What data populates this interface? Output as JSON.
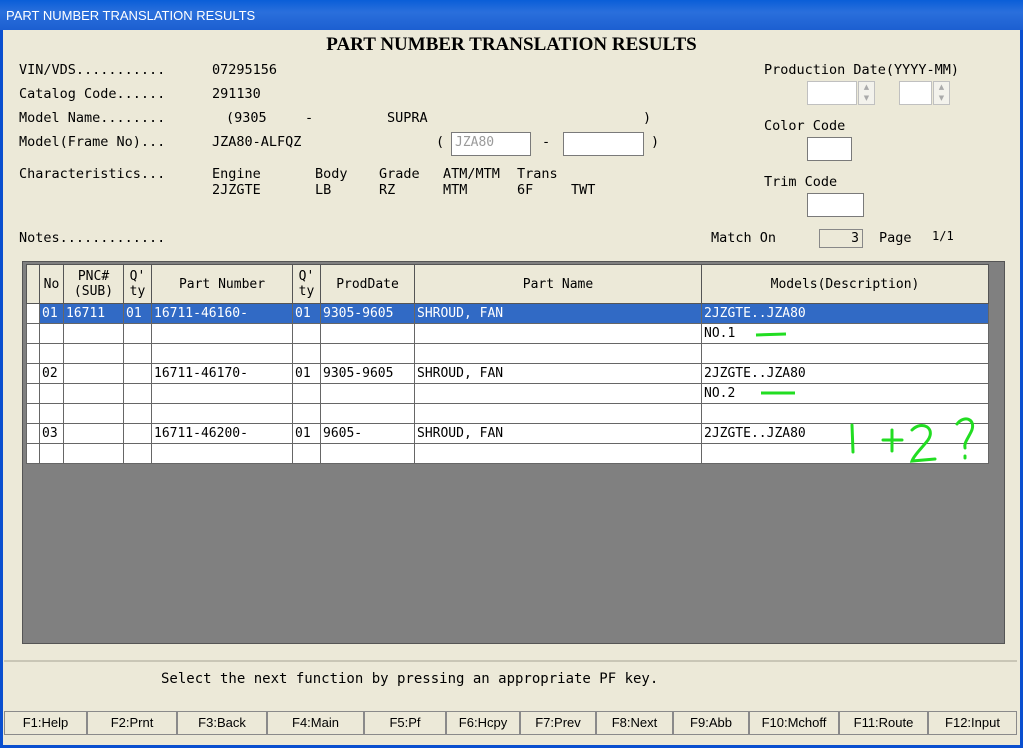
{
  "window": {
    "title": "PART NUMBER TRANSLATION RESULTS"
  },
  "heading": "PART NUMBER TRANSLATION RESULTS",
  "info": {
    "vin_label": "VIN/VDS...........",
    "vin_value": "07295156",
    "catalog_label": "Catalog Code......",
    "catalog_value": "291130",
    "model_name_label": "Model Name........",
    "model_name_open": "(9305",
    "model_name_dash": "-",
    "model_name_value": "SUPRA",
    "model_name_close": ")",
    "frame_label": "Model(Frame No)...",
    "frame_value": "JZA80-ALFQZ",
    "frame_open": "(",
    "frame_input_value": "JZA80",
    "frame_dash": "-",
    "frame_close": ")"
  },
  "characteristics": {
    "label": "Characteristics...",
    "headers": [
      "Engine",
      "Body",
      "Grade",
      "ATM/MTM",
      "Trans"
    ],
    "values": [
      "2JZGTE",
      "LB",
      "RZ",
      "MTM",
      "6F",
      "TWT"
    ]
  },
  "right_panel": {
    "production_date_label": "Production Date(YYYY-MM)",
    "color_code_label": "Color Code",
    "trim_code_label": "Trim Code"
  },
  "notes_label": "Notes.............",
  "match_on_label": "Match On",
  "match_on_value": "3",
  "page_label": "Page",
  "page_value": "1/1",
  "table": {
    "columns": [
      "No",
      "PNC#\n(SUB)",
      "Q'\nty",
      "Part Number",
      "Q'\nty",
      "ProdDate",
      "Part Name",
      "Models(Description)"
    ],
    "rows": [
      [
        "01",
        "16711",
        "01",
        "16711-46160-",
        "01",
        "9305-9605",
        "SHROUD, FAN",
        "2JZGTE..JZA80"
      ],
      [
        "",
        "",
        "",
        "",
        "",
        "",
        "",
        "NO.1"
      ],
      [
        "",
        "",
        "",
        "",
        "",
        "",
        "",
        ""
      ],
      [
        "02",
        "",
        "",
        "16711-46170-",
        "01",
        "9305-9605",
        "SHROUD, FAN",
        "2JZGTE..JZA80"
      ],
      [
        "",
        "",
        "",
        "",
        "",
        "",
        "",
        "NO.2"
      ],
      [
        "",
        "",
        "",
        "",
        "",
        "",
        "",
        ""
      ],
      [
        "03",
        "",
        "",
        "16711-46200-",
        "01",
        "9605-",
        "SHROUD, FAN",
        "2JZGTE..JZA80"
      ],
      [
        "",
        "",
        "",
        "",
        "",
        "",
        "",
        ""
      ]
    ]
  },
  "annotation": {
    "text": "1 +2 ?",
    "color": "#22dd22"
  },
  "status_message": "Select the next function by pressing an appropriate PF key.",
  "fkeys": [
    "F1:Help",
    "F2:Prnt",
    "F3:Back",
    "F4:Main",
    "F5:Pf",
    "F6:Hcpy",
    "F7:Prev",
    "F8:Next",
    "F9:Abb",
    "F10:Mchoff",
    "F11:Route",
    "F12:Input"
  ]
}
